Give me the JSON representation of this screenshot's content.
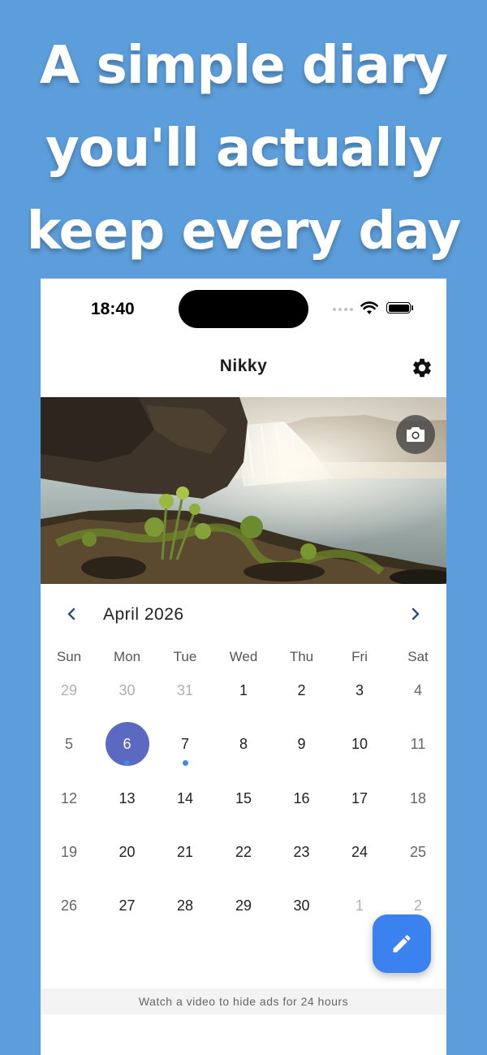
{
  "headline": {
    "line1": "A simple diary",
    "line2": "you'll actually",
    "line3": "keep every day"
  },
  "status_bar": {
    "time": "18:40"
  },
  "app_bar": {
    "title": "Nikky",
    "settings_icon": "gear-icon"
  },
  "hero": {
    "camera_icon": "camera-icon"
  },
  "calendar": {
    "month_label": "April 2026",
    "prev_icon": "chevron-left-icon",
    "next_icon": "chevron-right-icon",
    "weekdays": [
      "Sun",
      "Mon",
      "Tue",
      "Wed",
      "Thu",
      "Fri",
      "Sat"
    ],
    "weeks": [
      [
        {
          "d": "29",
          "t": "other"
        },
        {
          "d": "30",
          "t": "other"
        },
        {
          "d": "31",
          "t": "other"
        },
        {
          "d": "1",
          "t": "norm"
        },
        {
          "d": "2",
          "t": "norm"
        },
        {
          "d": "3",
          "t": "norm"
        },
        {
          "d": "4",
          "t": "weekend"
        }
      ],
      [
        {
          "d": "5",
          "t": "weekend"
        },
        {
          "d": "6",
          "t": "sel",
          "dot": true
        },
        {
          "d": "7",
          "t": "norm",
          "dot": true
        },
        {
          "d": "8",
          "t": "norm"
        },
        {
          "d": "9",
          "t": "norm"
        },
        {
          "d": "10",
          "t": "norm"
        },
        {
          "d": "11",
          "t": "weekend"
        }
      ],
      [
        {
          "d": "12",
          "t": "weekend"
        },
        {
          "d": "13",
          "t": "norm"
        },
        {
          "d": "14",
          "t": "norm"
        },
        {
          "d": "15",
          "t": "norm"
        },
        {
          "d": "16",
          "t": "norm"
        },
        {
          "d": "17",
          "t": "norm"
        },
        {
          "d": "18",
          "t": "weekend"
        }
      ],
      [
        {
          "d": "19",
          "t": "weekend"
        },
        {
          "d": "20",
          "t": "norm"
        },
        {
          "d": "21",
          "t": "norm"
        },
        {
          "d": "22",
          "t": "norm"
        },
        {
          "d": "23",
          "t": "norm"
        },
        {
          "d": "24",
          "t": "norm"
        },
        {
          "d": "25",
          "t": "weekend"
        }
      ],
      [
        {
          "d": "26",
          "t": "weekend"
        },
        {
          "d": "27",
          "t": "norm"
        },
        {
          "d": "28",
          "t": "norm"
        },
        {
          "d": "29",
          "t": "norm"
        },
        {
          "d": "30",
          "t": "norm"
        },
        {
          "d": "1",
          "t": "other"
        },
        {
          "d": "2",
          "t": "other"
        }
      ]
    ],
    "selected_color": "#5b69c1",
    "entry_dot_color": "#4488e8"
  },
  "fab": {
    "icon": "pencil-icon",
    "color": "#3b82f0"
  },
  "ad_bar": {
    "text": "Watch a video to hide ads for 24 hours"
  }
}
